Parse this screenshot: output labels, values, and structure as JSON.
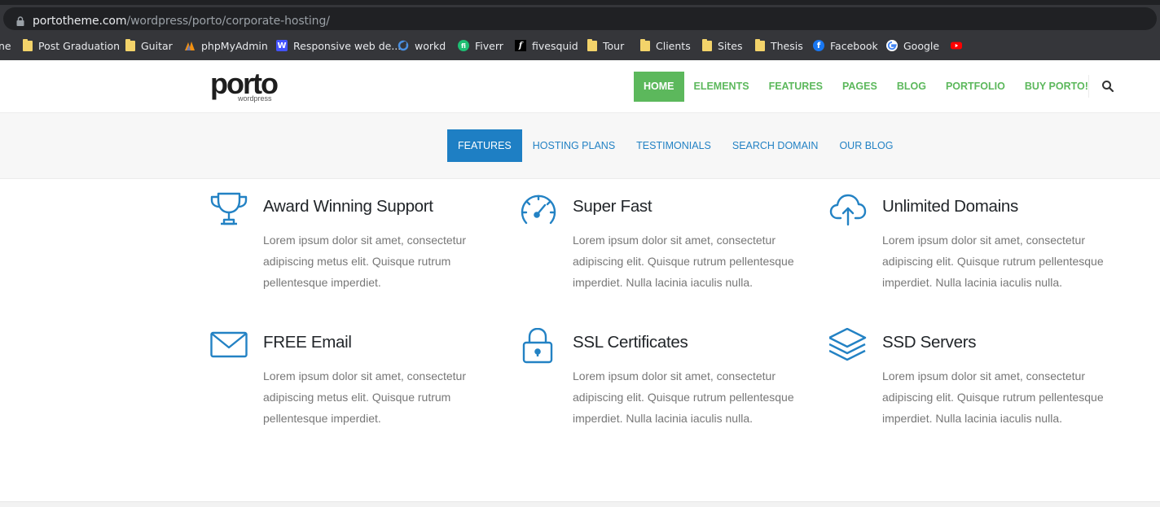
{
  "browser": {
    "url_host": "portotheme.com",
    "url_path": "/wordpress/porto/corporate-hosting/",
    "bookmarks": [
      {
        "label": "ne",
        "icon": "folder-icon"
      },
      {
        "label": "Post Graduation",
        "icon": "folder-icon"
      },
      {
        "label": "Guitar",
        "icon": "folder-icon"
      },
      {
        "label": "phpMyAdmin",
        "icon": "phpmyadmin-icon"
      },
      {
        "label": "Responsive web de...",
        "icon": "webflow-icon"
      },
      {
        "label": "workd",
        "icon": "workd-icon"
      },
      {
        "label": "Fiverr",
        "icon": "fiverr-icon"
      },
      {
        "label": "fivesquid",
        "icon": "fivesquid-icon"
      },
      {
        "label": "Tour",
        "icon": "folder-icon"
      },
      {
        "label": "Clients",
        "icon": "folder-icon"
      },
      {
        "label": "Sites",
        "icon": "folder-icon"
      },
      {
        "label": "Thesis",
        "icon": "folder-icon"
      },
      {
        "label": "Facebook",
        "icon": "facebook-icon"
      },
      {
        "label": "Google",
        "icon": "google-icon"
      },
      {
        "label": "",
        "icon": "youtube-icon"
      }
    ]
  },
  "site": {
    "logo_text": "porto",
    "logo_sub": "wordpress",
    "nav": [
      {
        "label": "HOME",
        "active": true
      },
      {
        "label": "ELEMENTS",
        "active": false
      },
      {
        "label": "FEATURES",
        "active": false
      },
      {
        "label": "PAGES",
        "active": false
      },
      {
        "label": "BLOG",
        "active": false
      },
      {
        "label": "PORTFOLIO",
        "active": false
      },
      {
        "label": "BUY PORTO!",
        "active": false
      }
    ],
    "accent_green": "#5cb85c",
    "accent_blue": "#1e7fc4"
  },
  "subnav": [
    {
      "label": "FEATURES",
      "active": true
    },
    {
      "label": "HOSTING PLANS",
      "active": false
    },
    {
      "label": "TESTIMONIALS",
      "active": false
    },
    {
      "label": "SEARCH DOMAIN",
      "active": false
    },
    {
      "label": "OUR BLOG",
      "active": false
    }
  ],
  "features": [
    {
      "title": "Award Winning Support",
      "icon": "trophy-icon",
      "desc": "Lorem ipsum dolor sit amet, consectetur adipiscing metus elit. Quisque rutrum pellentesque imperdiet."
    },
    {
      "title": "Super Fast",
      "icon": "speedometer-icon",
      "desc": "Lorem ipsum dolor sit amet, consectetur adipiscing elit. Quisque rutrum pellentesque imperdiet. Nulla lacinia iaculis nulla."
    },
    {
      "title": "Unlimited Domains",
      "icon": "cloud-upload-icon",
      "desc": "Lorem ipsum dolor sit amet, consectetur adipiscing elit. Quisque rutrum pellentesque imperdiet. Nulla lacinia iaculis nulla."
    },
    {
      "title": "FREE Email",
      "icon": "envelope-icon",
      "desc": "Lorem ipsum dolor sit amet, consectetur adipiscing metus elit. Quisque rutrum pellentesque imperdiet."
    },
    {
      "title": "SSL Certificates",
      "icon": "lock-icon",
      "desc": "Lorem ipsum dolor sit amet, consectetur adipiscing elit. Quisque rutrum pellentesque imperdiet. Nulla lacinia iaculis nulla."
    },
    {
      "title": "SSD Servers",
      "icon": "layers-icon",
      "desc": "Lorem ipsum dolor sit amet, consectetur adipiscing elit. Quisque rutrum pellentesque imperdiet. Nulla lacinia iaculis nulla."
    }
  ]
}
